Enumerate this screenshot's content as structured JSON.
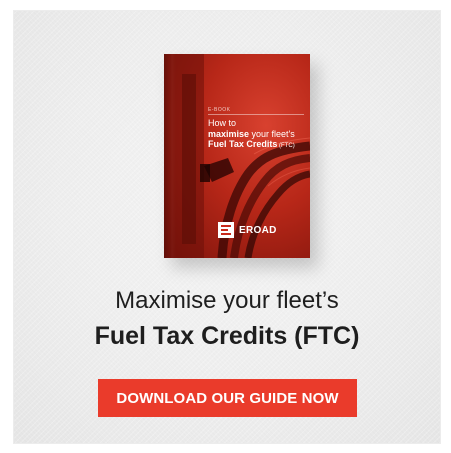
{
  "book": {
    "tag": "E-BOOK",
    "title_line1": "How to",
    "title_line2_bold": "maximise",
    "title_line2_rest": " your fleet's",
    "title_line3_bold": "Fuel Tax Credits",
    "title_line3_small": " (FTC)",
    "brand": "EROAD"
  },
  "headline": {
    "line1": "Maximise your fleet’s",
    "line2": "Fuel Tax Credits (FTC)"
  },
  "cta": {
    "label": "DOWNLOAD OUR GUIDE NOW"
  },
  "colors": {
    "accent": "#ea3b2b",
    "cover_red": "#b72718",
    "text": "#1e1e1e",
    "background": "#eeeeee"
  },
  "icons": {
    "brand_mark": "eroad-logo-icon",
    "cover_image": "fuel-pump-nozzle"
  }
}
